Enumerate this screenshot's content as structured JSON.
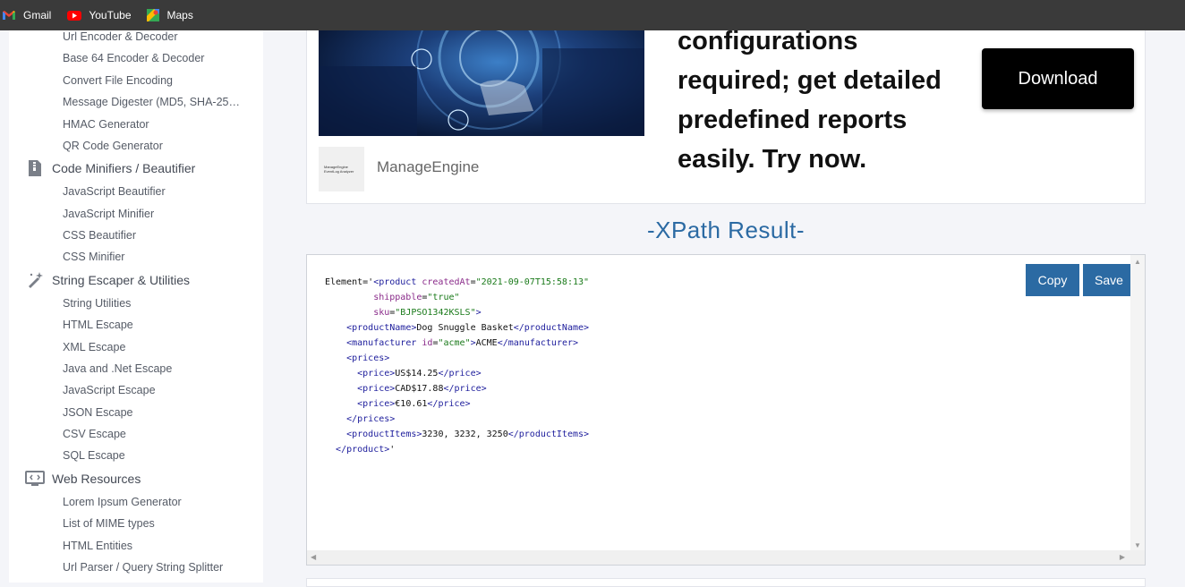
{
  "bookmarks": [
    {
      "label": "Gmail",
      "icon": "gmail-icon"
    },
    {
      "label": "YouTube",
      "icon": "youtube-icon"
    },
    {
      "label": "Maps",
      "icon": "maps-icon"
    }
  ],
  "sidebar": {
    "top_items": [
      "Url Encoder & Decoder",
      "Base 64 Encoder & Decoder",
      "Convert File Encoding",
      "Message Digester (MD5, SHA-25…",
      "HMAC Generator",
      "QR Code Generator"
    ],
    "cat_minifiers": "Code Minifiers / Beautifier",
    "minifier_items": [
      "JavaScript Beautifier",
      "JavaScript Minifier",
      "CSS Beautifier",
      "CSS Minifier"
    ],
    "cat_escaper": "String Escaper & Utilities",
    "escaper_items": [
      "String Utilities",
      "HTML Escape",
      "XML Escape",
      "Java and .Net Escape",
      "JavaScript Escape",
      "JSON Escape",
      "CSV Escape",
      "SQL Escape"
    ],
    "cat_web": "Web Resources",
    "web_items": [
      "Lorem Ipsum Generator",
      "List of MIME types",
      "HTML Entities",
      "Url Parser / Query String Splitter"
    ]
  },
  "ad": {
    "logo_text_1": "ManageEngine",
    "logo_text_2": "EventLog Analyzer",
    "brand": "ManageEngine",
    "headline": "configurations required; get detailed predefined reports easily. Try now.",
    "download_label": "Download"
  },
  "result": {
    "title": "-XPath Result-",
    "copy_label": "Copy",
    "save_label": "Save",
    "code_lines": [
      [
        [
          "t",
          "Element='"
        ],
        [
          "g",
          "<product "
        ],
        [
          "a",
          "createdAt"
        ],
        [
          "t",
          "="
        ],
        [
          "v",
          "\"2021-09-07T15:58:13\""
        ]
      ],
      [
        [
          "t",
          "         "
        ],
        [
          "a",
          "shippable"
        ],
        [
          "t",
          "="
        ],
        [
          "v",
          "\"true\""
        ]
      ],
      [
        [
          "t",
          "         "
        ],
        [
          "a",
          "sku"
        ],
        [
          "t",
          "="
        ],
        [
          "v",
          "\"BJPSO1342KSLS\""
        ],
        [
          "g",
          ">"
        ]
      ],
      [
        [
          "t",
          "    "
        ],
        [
          "g",
          "<productName>"
        ],
        [
          "t",
          "Dog Snuggle Basket"
        ],
        [
          "g",
          "</productName>"
        ]
      ],
      [
        [
          "t",
          "    "
        ],
        [
          "g",
          "<manufacturer "
        ],
        [
          "a",
          "id"
        ],
        [
          "t",
          "="
        ],
        [
          "v",
          "\"acme\""
        ],
        [
          "g",
          ">"
        ],
        [
          "t",
          "ACME"
        ],
        [
          "g",
          "</manufacturer>"
        ]
      ],
      [
        [
          "t",
          "    "
        ],
        [
          "g",
          "<prices>"
        ]
      ],
      [
        [
          "t",
          "      "
        ],
        [
          "g",
          "<price>"
        ],
        [
          "t",
          "US$14.25"
        ],
        [
          "g",
          "</price>"
        ]
      ],
      [
        [
          "t",
          "      "
        ],
        [
          "g",
          "<price>"
        ],
        [
          "t",
          "CAD$17.88"
        ],
        [
          "g",
          "</price>"
        ]
      ],
      [
        [
          "t",
          "      "
        ],
        [
          "g",
          "<price>"
        ],
        [
          "t",
          "€10.61"
        ],
        [
          "g",
          "</price>"
        ]
      ],
      [
        [
          "t",
          "    "
        ],
        [
          "g",
          "</prices>"
        ]
      ],
      [
        [
          "t",
          "    "
        ],
        [
          "g",
          "<productItems>"
        ],
        [
          "t",
          "3230, 3232, 3250"
        ],
        [
          "g",
          "</productItems>"
        ]
      ],
      [
        [
          "t",
          "  "
        ],
        [
          "g",
          "</product>"
        ],
        [
          "t",
          "'"
        ]
      ]
    ]
  }
}
